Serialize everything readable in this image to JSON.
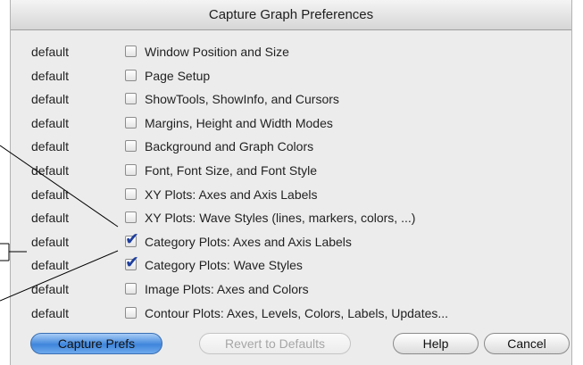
{
  "window": {
    "title": "Capture Graph Preferences"
  },
  "rows": [
    {
      "status": "default",
      "label": "Window Position and Size",
      "checked": false
    },
    {
      "status": "default",
      "label": "Page Setup",
      "checked": false
    },
    {
      "status": "default",
      "label": "ShowTools, ShowInfo, and Cursors",
      "checked": false
    },
    {
      "status": "default",
      "label": "Margins, Height and Width Modes",
      "checked": false
    },
    {
      "status": "default",
      "label": "Background and Graph Colors",
      "checked": false
    },
    {
      "status": "default",
      "label": "Font, Font Size, and Font Style",
      "checked": false
    },
    {
      "status": "default",
      "label": "XY Plots: Axes and Axis Labels",
      "checked": false
    },
    {
      "status": "default",
      "label": "XY Plots: Wave Styles (lines, markers, colors, ...)",
      "checked": false
    },
    {
      "status": "default",
      "label": "Category Plots: Axes and Axis Labels",
      "checked": true
    },
    {
      "status": "default",
      "label": "Category Plots: Wave Styles",
      "checked": true
    },
    {
      "status": "default",
      "label": "Image Plots: Axes and Colors",
      "checked": false
    },
    {
      "status": "default",
      "label": "Contour Plots: Axes, Levels, Colors, Labels, Updates...",
      "checked": false
    }
  ],
  "buttons": {
    "capture": "Capture Prefs",
    "revert": "Revert to Defaults",
    "help": "Help",
    "cancel": "Cancel"
  },
  "colors": {
    "accent": "#3f86dc",
    "checkmark": "#1f3f9e"
  }
}
